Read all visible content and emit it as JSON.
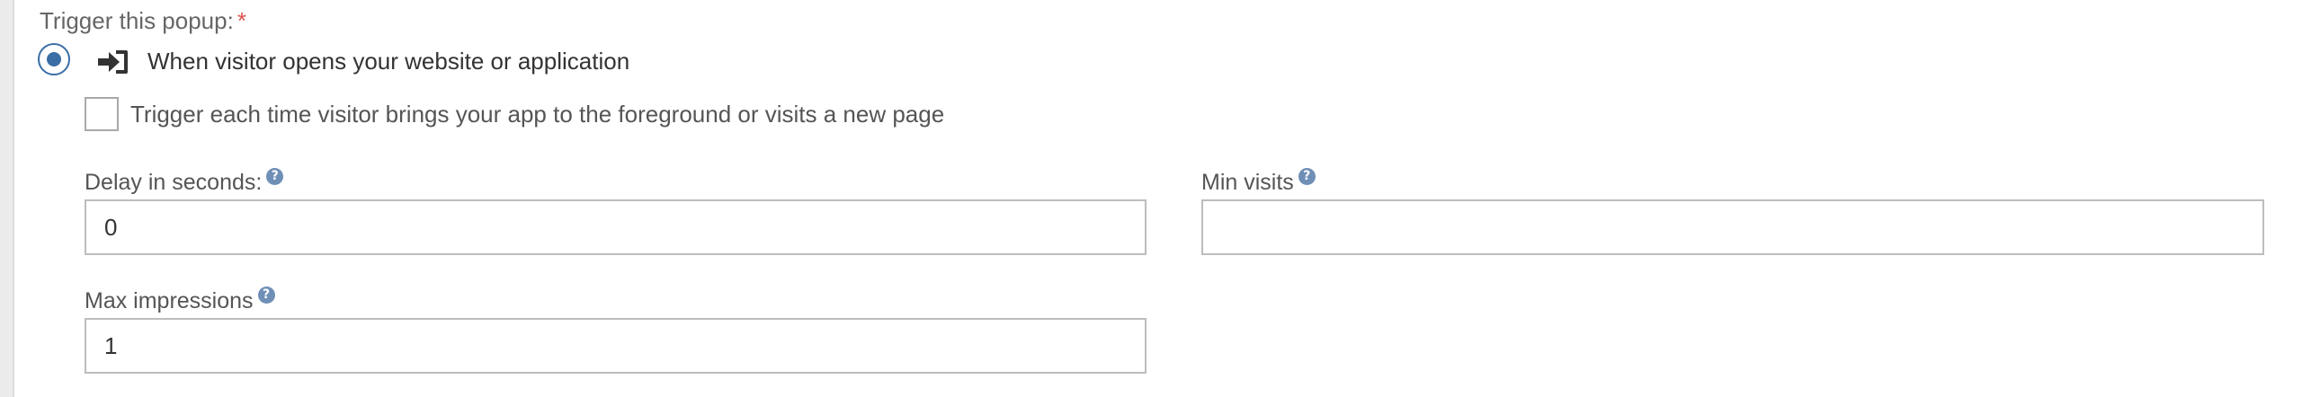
{
  "trigger": {
    "label": "Trigger this popup:",
    "required_mark": "*",
    "option_label": "When visitor opens your website or application",
    "option_icon": "sign-in-icon",
    "option_selected": true,
    "repeat_checkbox_label": "Trigger each time visitor brings your app to the foreground or visits a new page",
    "repeat_checked": false
  },
  "fields": {
    "delay": {
      "label": "Delay in seconds:",
      "value": "0"
    },
    "min_visits": {
      "label": "Min visits",
      "value": ""
    },
    "max_impressions": {
      "label": "Max impressions",
      "value": "1"
    },
    "help_glyph": "?"
  },
  "colors": {
    "accent": "#3a6ea5",
    "required": "#d9534f",
    "help_icon": "#6f8fb7"
  }
}
